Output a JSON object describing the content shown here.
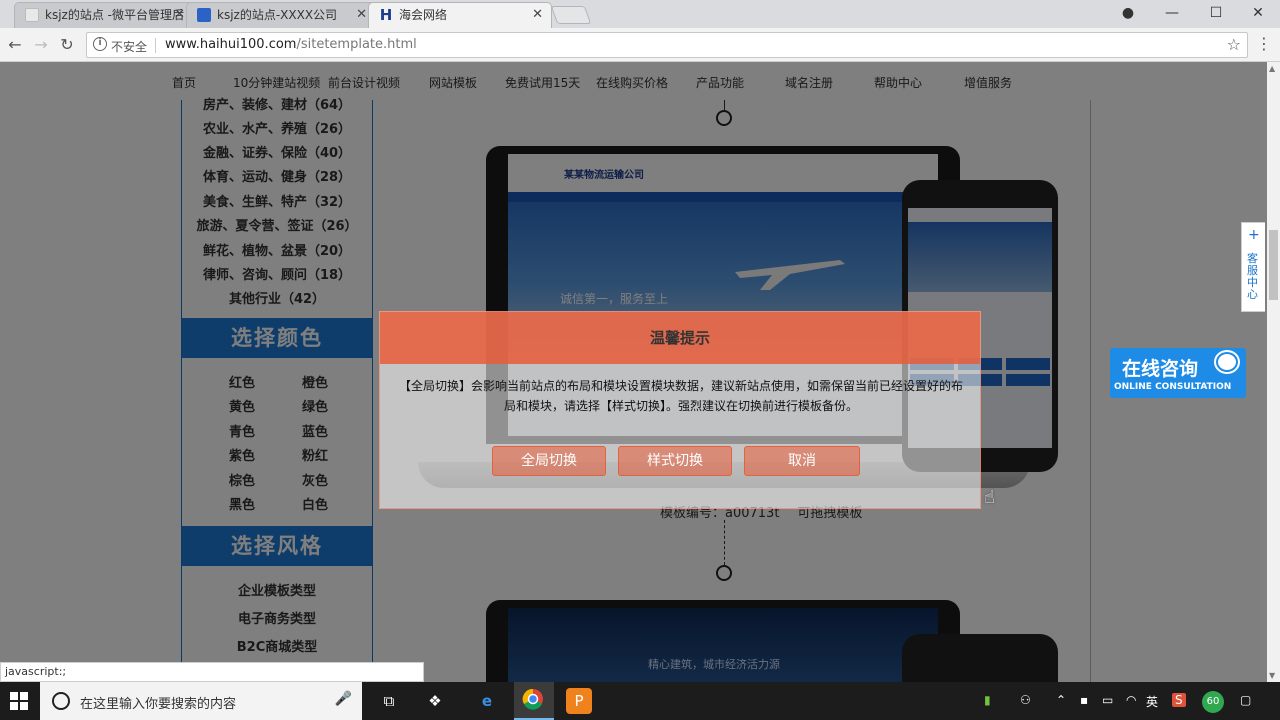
{
  "browser": {
    "tabs": [
      {
        "title": "ksjz的站点 -微平台管理后",
        "close": "✕"
      },
      {
        "title": "ksjz的站点-XXXX公司",
        "close": "✕"
      },
      {
        "title": "海会网络",
        "close": "✕"
      }
    ],
    "window_controls": {
      "minimize": "—",
      "maximize": "☐",
      "close": "✕"
    },
    "address": {
      "security": "不安全",
      "host": "www.haihui100.com",
      "path": "/sitetemplate.html"
    },
    "status_url": "javascript:;"
  },
  "site": {
    "nav": [
      "首页",
      "10分钟建站视频",
      "前台设计视频",
      "网站模板",
      "免费试用15天",
      "在线购买价格",
      "产品功能",
      "域名注册",
      "帮助中心",
      "增值服务"
    ],
    "categories": [
      "房产、装修、建材（64）",
      "农业、水产、养殖（26）",
      "金融、证券、保险（40）",
      "体育、运动、健身（28）",
      "美食、生鲜、特产（32）",
      "旅游、夏令营、签证（26）",
      "鲜花、植物、盆景（20）",
      "律师、咨询、顾问（18）",
      "其他行业（42）"
    ],
    "color_section": {
      "title": "选择颜色",
      "colors": [
        "红色",
        "橙色",
        "黄色",
        "绿色",
        "青色",
        "蓝色",
        "紫色",
        "粉红",
        "棕色",
        "灰色",
        "黑色",
        "白色"
      ]
    },
    "style_section": {
      "title": "选择风格",
      "styles": [
        "企业模板类型",
        "电子商务类型",
        "B2C商城类型"
      ]
    },
    "template": {
      "number": "模板编号：a00713t",
      "drag": "可拖拽模板",
      "company": "某某物流运输公司",
      "slogan": "诚信第一，服务至上",
      "slogan2": "精心建筑，城市经济活力源"
    },
    "float_tab": {
      "plus": "+",
      "label": "客服中心"
    },
    "consult": {
      "big": "在线咨询",
      "small": "ONLINE CONSULTATION"
    }
  },
  "dialog": {
    "title": "温馨提示",
    "message": "【全局切换】会影响当前站点的布局和模块设置模块数据，建议新站点使用，如需保留当前已经设置好的布局和模块，请选择【样式切换】。强烈建议在切换前进行模板备份。",
    "buttons": {
      "global": "全局切换",
      "style": "样式切换",
      "cancel": "取消"
    }
  },
  "taskbar": {
    "search_placeholder": "在这里输入你要搜索的内容",
    "ime": "英",
    "badge": "60"
  },
  "colors": {
    "accent_blue": "#1f7ad6",
    "dialog_orange": "#e85c38"
  }
}
